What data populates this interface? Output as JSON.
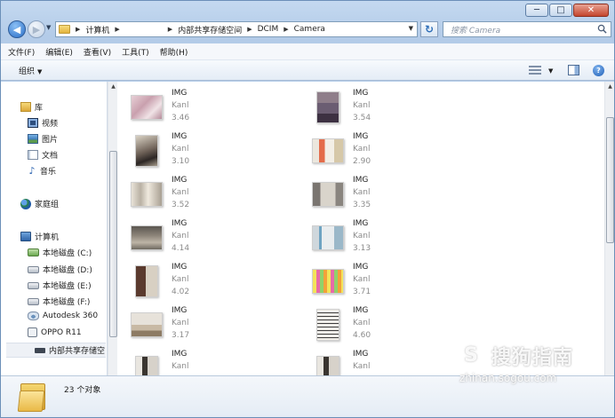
{
  "window": {
    "minimize": "─",
    "maximize": "□",
    "close": "✕"
  },
  "nav": {
    "back": "◀",
    "forward": "▶",
    "history": "▼",
    "breadcrumbs": [
      "计算机",
      "内部共享存储空间",
      "DCIM",
      "Camera"
    ],
    "refresh": "↻",
    "search_placeholder": "搜索 Camera"
  },
  "menu": [
    "文件(F)",
    "编辑(E)",
    "查看(V)",
    "工具(T)",
    "帮助(H)"
  ],
  "toolbar": {
    "organize": "组织",
    "dropdown": "▼",
    "help": "?"
  },
  "sidebar": {
    "library": "库",
    "lib_items": [
      "视频",
      "图片",
      "文档",
      "音乐"
    ],
    "homegroup": "家庭组",
    "computer": "计算机",
    "drives": [
      "本地磁盘 (C:)",
      "本地磁盘 (D:)",
      "本地磁盘 (E:)",
      "本地磁盘 (F:)",
      "Autodesk 360",
      "OPPO R11"
    ],
    "share": "内部共享存储空",
    "music_glyph": "♪"
  },
  "files": [
    {
      "name": "IMG",
      "sub": "Kanl",
      "size": "3.46",
      "theme": "blur-pink"
    },
    {
      "name": "IMG",
      "sub": "Kanl",
      "size": "3.54",
      "theme": "portrait"
    },
    {
      "name": "IMG",
      "sub": "Kanl",
      "size": "3.10",
      "theme": "person"
    },
    {
      "name": "IMG",
      "sub": "Kanl",
      "size": "2.90",
      "theme": "poster"
    },
    {
      "name": "IMG",
      "sub": "Kanl",
      "size": "3.52",
      "theme": "wall"
    },
    {
      "name": "IMG",
      "sub": "Kanl",
      "size": "3.35",
      "theme": "door"
    },
    {
      "name": "IMG",
      "sub": "Kanl",
      "size": "4.14",
      "theme": "floor"
    },
    {
      "name": "IMG",
      "sub": "Kanl",
      "size": "3.13",
      "theme": "room"
    },
    {
      "name": "IMG",
      "sub": "Kanl",
      "size": "4.02",
      "theme": "cabinet"
    },
    {
      "name": "IMG",
      "sub": "Kanl",
      "size": "3.71",
      "theme": "colorful"
    },
    {
      "name": "IMG",
      "sub": "Kanl",
      "size": "3.17",
      "theme": "desk"
    },
    {
      "name": "IMG",
      "sub": "Kanl",
      "size": "4.60",
      "theme": "document"
    },
    {
      "name": "IMG",
      "sub": "Kanl",
      "size": "",
      "theme": "stripe"
    },
    {
      "name": "IMG",
      "sub": "Kanl",
      "size": "",
      "theme": "stripe"
    }
  ],
  "status": {
    "count": "23 个对象"
  },
  "watermark": {
    "logo": "S",
    "text": "搜狗指南",
    "url": "zhinan.sogou.com"
  }
}
